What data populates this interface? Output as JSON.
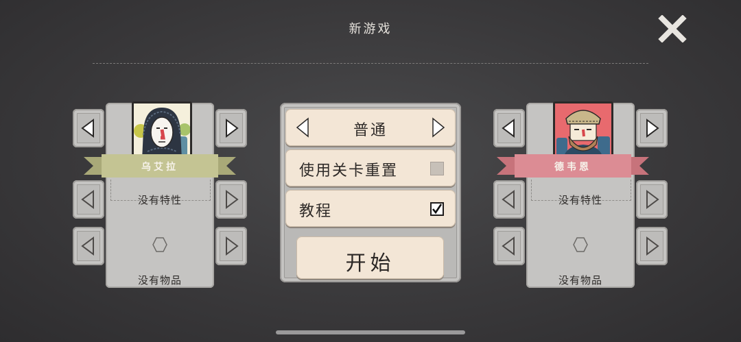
{
  "header": {
    "title": "新游戏"
  },
  "icons": {
    "close": "close-x-icon",
    "nav_left": "arrow-left-icon",
    "nav_right": "arrow-right-icon",
    "item_slot": "hexagon-slot-icon"
  },
  "left_character": {
    "name": "乌艾拉",
    "ribbon_color": "#c4c493",
    "trait_text": "没有特性",
    "item_text": "没有物品"
  },
  "right_character": {
    "name": "德韦恩",
    "ribbon_color": "#dc8c94",
    "trait_text": "没有特性",
    "item_text": "没有物品"
  },
  "settings": {
    "difficulty": "普通",
    "reset_levels": {
      "label": "使用关卡重置",
      "checked": false
    },
    "tutorial": {
      "label": "教程",
      "checked": true
    },
    "start_label": "开始"
  },
  "colors": {
    "background": "#3a393b",
    "panel": "#c5c4c2",
    "option_bg": "#f3e6d6"
  }
}
